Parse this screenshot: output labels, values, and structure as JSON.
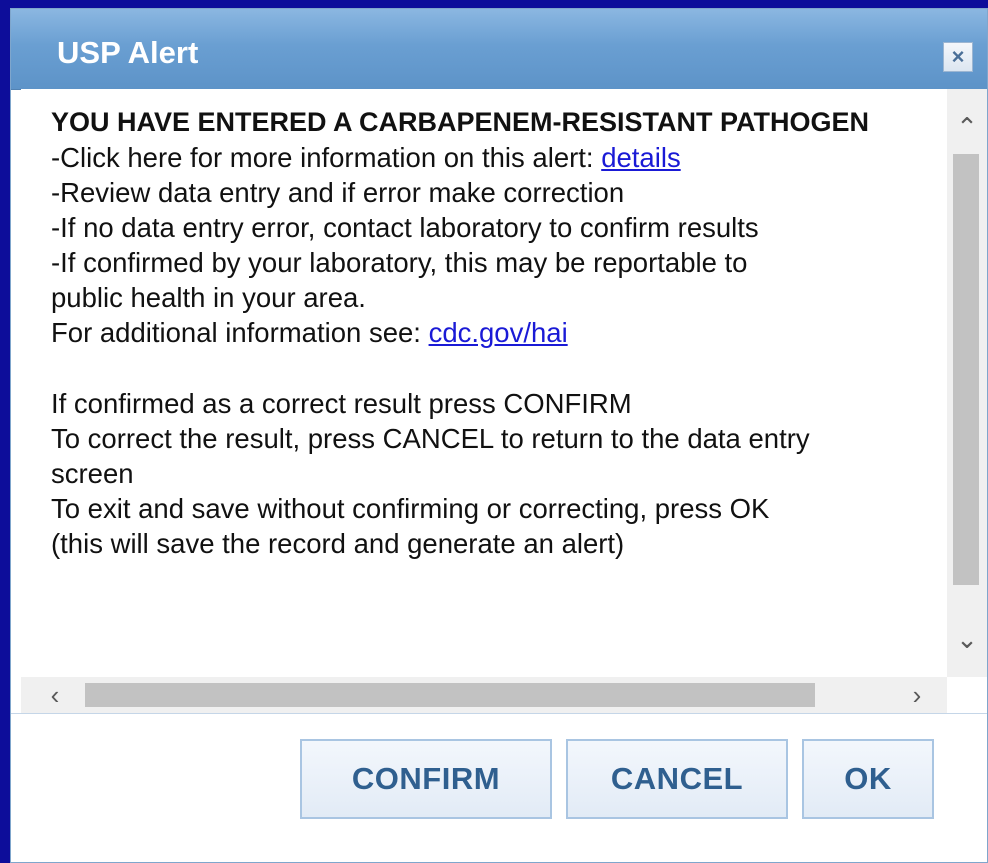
{
  "dialog": {
    "title": "USP Alert",
    "close_symbol": "×",
    "close_icon": "close-icon"
  },
  "message": {
    "heading": "YOU HAVE ENTERED A CARBAPENEM-RESISTANT PATHOGEN",
    "line1_prefix": "-Click here for more information on this alert: ",
    "line1_link": "details",
    "line2": "-Review data entry and if error make correction",
    "line3": "-If no data entry error, contact laboratory to confirm results",
    "line4a": "-If confirmed by your laboratory, this may be reportable to",
    "line4b": "public health in your area.",
    "line5_prefix": "For additional information see: ",
    "line5_link": "cdc.gov/hai",
    "line6": "If confirmed as a correct result press CONFIRM",
    "line7a": "To correct the result, press CANCEL to return to the data entry",
    "line7b": "screen",
    "line8": "To exit and save without confirming or correcting, press OK",
    "line9": "(this will save the record and generate an alert)"
  },
  "scrollbars": {
    "up_arrow": "⌃",
    "down_arrow": "⌄",
    "left_arrow": "‹",
    "right_arrow": "›"
  },
  "buttons": {
    "confirm": "CONFIRM",
    "cancel": "CANCEL",
    "ok": "OK"
  },
  "colors": {
    "background": "#0d0d9a",
    "titlebar": "#6a9fd2",
    "link": "#1a1ad6",
    "button_text": "#2f5f8f"
  }
}
